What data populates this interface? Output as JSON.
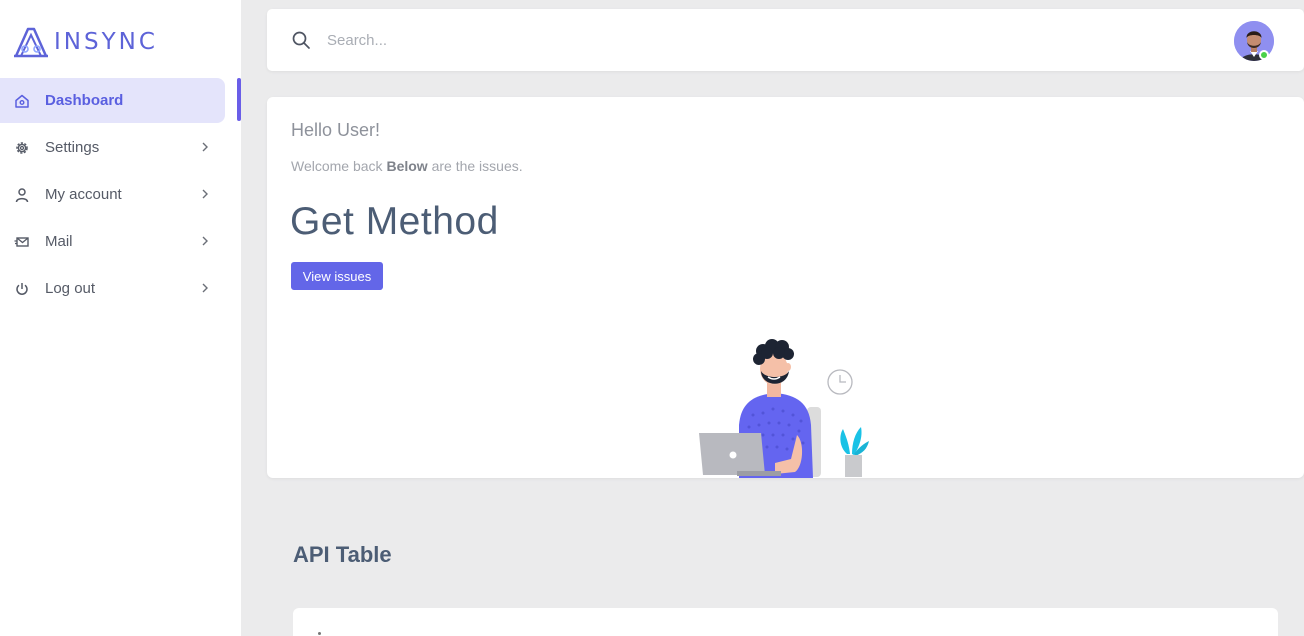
{
  "brand": {
    "name": "INSYNC",
    "accent": "#5d63d8"
  },
  "sidebar": {
    "items": [
      {
        "label": "Dashboard",
        "icon": "home-icon",
        "active": true
      },
      {
        "label": "Settings",
        "icon": "gear-icon"
      },
      {
        "label": "My account",
        "icon": "user-icon"
      },
      {
        "label": "Mail",
        "icon": "mail-icon"
      },
      {
        "label": "Log out",
        "icon": "power-icon"
      }
    ]
  },
  "search": {
    "placeholder": "Search...",
    "value": ""
  },
  "hero": {
    "greeting": "Hello User!",
    "welcome_prefix": "Welcome back ",
    "welcome_bold": "Below",
    "welcome_suffix": " are the issues.",
    "title": "Get Method",
    "button_label": "View issues",
    "button_color": "#6366e8"
  },
  "api_table": {
    "title": "API Table"
  }
}
